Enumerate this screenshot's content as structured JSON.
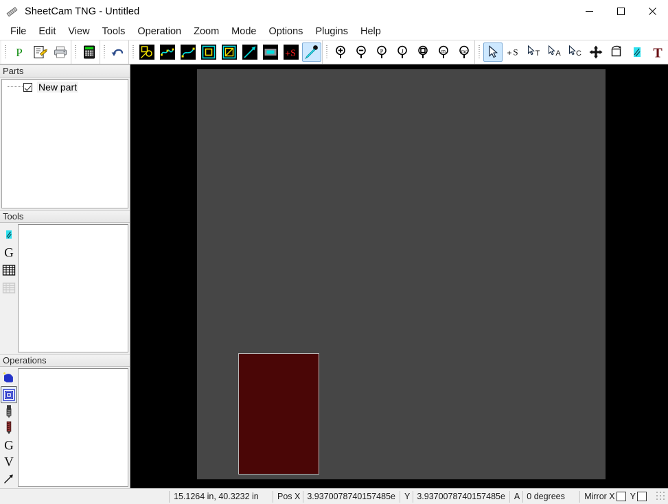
{
  "window": {
    "title": "SheetCam TNG - Untitled",
    "app_icon": "sheetcam-logo-icon",
    "controls": {
      "minimize": "minimize-icon",
      "maximize": "maximize-icon",
      "close": "close-icon"
    }
  },
  "menubar": {
    "items": [
      {
        "label": "File"
      },
      {
        "label": "Edit"
      },
      {
        "label": "View"
      },
      {
        "label": "Tools"
      },
      {
        "label": "Operation"
      },
      {
        "label": "Zoom"
      },
      {
        "label": "Mode"
      },
      {
        "label": "Options"
      },
      {
        "label": "Plugins"
      },
      {
        "label": "Help"
      }
    ]
  },
  "toolbar": {
    "groups": [
      {
        "name": "file-group",
        "buttons": [
          {
            "icon": "post-process-p-icon",
            "label": "P",
            "selected": false
          },
          {
            "icon": "edit-document-pencil-icon",
            "label": "",
            "selected": false
          },
          {
            "icon": "print-icon",
            "label": "",
            "selected": false
          }
        ]
      },
      {
        "name": "calculator-group",
        "buttons": [
          {
            "icon": "calculator-icon",
            "label": "",
            "selected": false
          }
        ]
      },
      {
        "name": "undo-group",
        "buttons": [
          {
            "icon": "undo-arrow-icon",
            "label": "",
            "selected": false
          }
        ]
      },
      {
        "name": "draw-group",
        "buttons": [
          {
            "icon": "select-shapes-icon",
            "label": "",
            "selected": false
          },
          {
            "icon": "polyline-node-icon",
            "label": "",
            "selected": false
          },
          {
            "icon": "spline-curve-icon",
            "label": "",
            "selected": false
          },
          {
            "icon": "offset-outline-icon",
            "label": "",
            "selected": false
          },
          {
            "icon": "diagonal-in-box-icon",
            "label": "",
            "selected": false
          },
          {
            "icon": "arrow-line-icon",
            "label": "",
            "selected": false
          },
          {
            "icon": "rectangle-fill-icon",
            "label": "",
            "selected": false
          },
          {
            "icon": "add-start-point-s-icon",
            "label": "+S",
            "selected": false
          },
          {
            "icon": "plasma-torch-icon",
            "label": "",
            "selected": true
          }
        ]
      },
      {
        "name": "zoom-group",
        "buttons": [
          {
            "icon": "zoom-in-icon",
            "label": "+",
            "selected": false
          },
          {
            "icon": "zoom-out-icon",
            "label": "-",
            "selected": false
          },
          {
            "icon": "zoom-part-p-icon",
            "label": "P",
            "selected": false
          },
          {
            "icon": "zoom-job-j-icon",
            "label": "J",
            "selected": false
          },
          {
            "icon": "zoom-extents-icon",
            "label": "",
            "selected": false
          },
          {
            "icon": "zoom-material-m-icon",
            "label": "m",
            "selected": false
          },
          {
            "icon": "zoom-mc-icon",
            "label": "mc",
            "selected": false
          }
        ]
      },
      {
        "name": "select-group",
        "buttons": [
          {
            "icon": "arrow-select-icon",
            "label": "",
            "selected": true
          },
          {
            "icon": "add-start-s-cursor-icon",
            "label": "+S",
            "selected": false
          },
          {
            "icon": "select-t-cursor-icon",
            "label": "T",
            "selected": false
          },
          {
            "icon": "select-a-cursor-icon",
            "label": "A",
            "selected": false
          },
          {
            "icon": "select-c-cursor-icon",
            "label": "C",
            "selected": false
          },
          {
            "icon": "move-pan-icon",
            "label": "",
            "selected": false
          },
          {
            "icon": "rotate-object-icon",
            "label": "",
            "selected": false
          },
          {
            "icon": "plasma-tool-icon",
            "label": "",
            "selected": false
          },
          {
            "icon": "text-tool-t-icon",
            "label": "T",
            "selected": false
          }
        ]
      }
    ]
  },
  "sidebar": {
    "panels": [
      {
        "name": "parts",
        "title": "Parts",
        "vtools": [],
        "tree": [
          {
            "label": "New part",
            "checked": true
          }
        ]
      },
      {
        "name": "tools",
        "title": "Tools",
        "vtools": [
          {
            "icon": "plasma-tool-icon",
            "selected": false
          },
          {
            "icon": "g-code-tool-icon",
            "selected": false
          },
          {
            "icon": "tool-table-icon",
            "selected": false
          },
          {
            "icon": "tool-table-disabled-icon",
            "selected": false
          }
        ],
        "items": []
      },
      {
        "name": "operations",
        "title": "Operations",
        "vtools": [
          {
            "icon": "outside-offset-cut-icon",
            "selected": false
          },
          {
            "icon": "pocket-spiral-icon",
            "selected": true
          },
          {
            "icon": "drill-bit-icon",
            "selected": false
          },
          {
            "icon": "tap-thread-icon",
            "selected": false
          },
          {
            "icon": "g-code-operation-icon",
            "selected": false
          },
          {
            "icon": "v-carve-icon",
            "selected": false
          },
          {
            "icon": "move-arrow-icon",
            "selected": false
          }
        ],
        "items": []
      }
    ]
  },
  "canvas": {
    "background_color": "#000000",
    "worksheet_color": "#464646",
    "part": {
      "name": "part-rectangle",
      "fill_color": "#4a0606",
      "border_color": "#b9b9b9"
    }
  },
  "statusbar": {
    "coordinates": "15.1264 in, 40.3232 in",
    "pos_x_label": "Pos X",
    "pos_x_value": "3.9370078740157485e",
    "pos_y_label": "Y",
    "pos_y_value": "3.9370078740157485e",
    "angle_label": "A",
    "angle_value": "0 degrees",
    "mirror_label": "Mirror X",
    "mirror_x_checked": false,
    "mirror_y_label": "Y",
    "mirror_y_checked": false
  }
}
